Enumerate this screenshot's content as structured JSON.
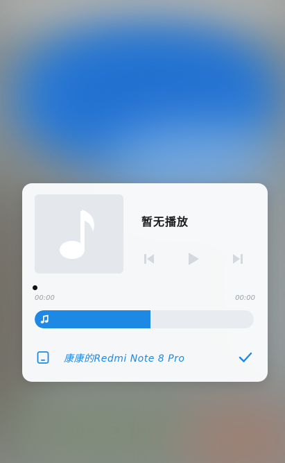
{
  "player": {
    "track_title": "暂无播放",
    "time_elapsed": "00:00",
    "time_total": "00:00",
    "volume_level_fraction": 0.53,
    "device_name": "康康的Redmi Note 8 Pro"
  },
  "icons": {
    "album_art": "music-note-icon",
    "previous": "skip-previous-icon",
    "play": "play-icon",
    "next": "skip-next-icon",
    "volume": "music-note-icon",
    "device": "phone-icon",
    "selected": "checkmark-icon"
  },
  "colors": {
    "accent": "#1e88e5",
    "card_bg": "#fafbfc",
    "album_bg": "#e4e7ec",
    "disabled_controls": "#d5d9df"
  }
}
